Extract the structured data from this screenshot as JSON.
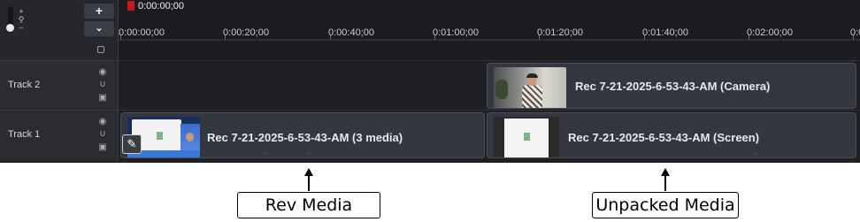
{
  "playhead": {
    "time": "0:00:00;00"
  },
  "ruler": {
    "ticks": [
      {
        "label": "0:00:00;00"
      },
      {
        "label": "0:00:20;00"
      },
      {
        "label": "0:00:40;00"
      },
      {
        "label": "0:01:00;00"
      },
      {
        "label": "0:01:20;00"
      },
      {
        "label": "0:01:40;00"
      },
      {
        "label": "0:02:00;00"
      },
      {
        "label": "0:0"
      }
    ]
  },
  "controls": {
    "add_label": "+",
    "expand_label": "⌄",
    "zoom_icon": "magnifier-icon"
  },
  "tracks": [
    {
      "name": "Track 2"
    },
    {
      "name": "Track 1"
    }
  ],
  "clips": {
    "camera": "Rec 7-21-2025-6-53-43-AM (Camera)",
    "rev": "Rec 7-21-2025-6-53-43-AM  (3 media)",
    "screen": "Rec 7-21-2025-6-53-43-AM (Screen)"
  },
  "callouts": {
    "rev": "Rev Media",
    "unpacked": "Unpacked Media"
  },
  "colors": {
    "background": "#1d1f23",
    "clip": "#343740",
    "playhead": "#c0191f"
  }
}
